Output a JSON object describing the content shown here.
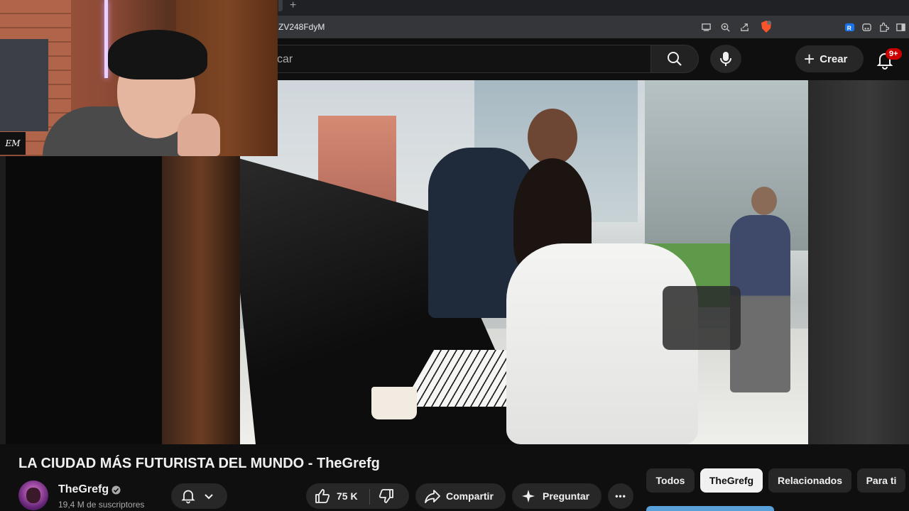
{
  "browser": {
    "url_fragment": "ZV248FdyM",
    "new_tab": "+"
  },
  "header": {
    "search_placeholder": "car",
    "create_label": "Crear",
    "create_plus": "+",
    "notifications_badge": "9+"
  },
  "webcam": {
    "watermark": "EM"
  },
  "video": {
    "title": "LA CIUDAD MÁS FUTURISTA DEL MUNDO - TheGrefg",
    "channel": "TheGrefg",
    "subscribers": "19,4 M de suscriptores",
    "likes": "75 K",
    "share_label": "Compartir",
    "ask_label": "Preguntar",
    "more_label": "•••"
  },
  "chips": [
    {
      "label": "Todos",
      "active": false
    },
    {
      "label": "TheGrefg",
      "active": true
    },
    {
      "label": "Relacionados",
      "active": false
    },
    {
      "label": "Para ti",
      "active": false
    }
  ],
  "colors": {
    "background": "#0f0f0f",
    "notif_red": "#cc0000",
    "pill": "#272727"
  }
}
